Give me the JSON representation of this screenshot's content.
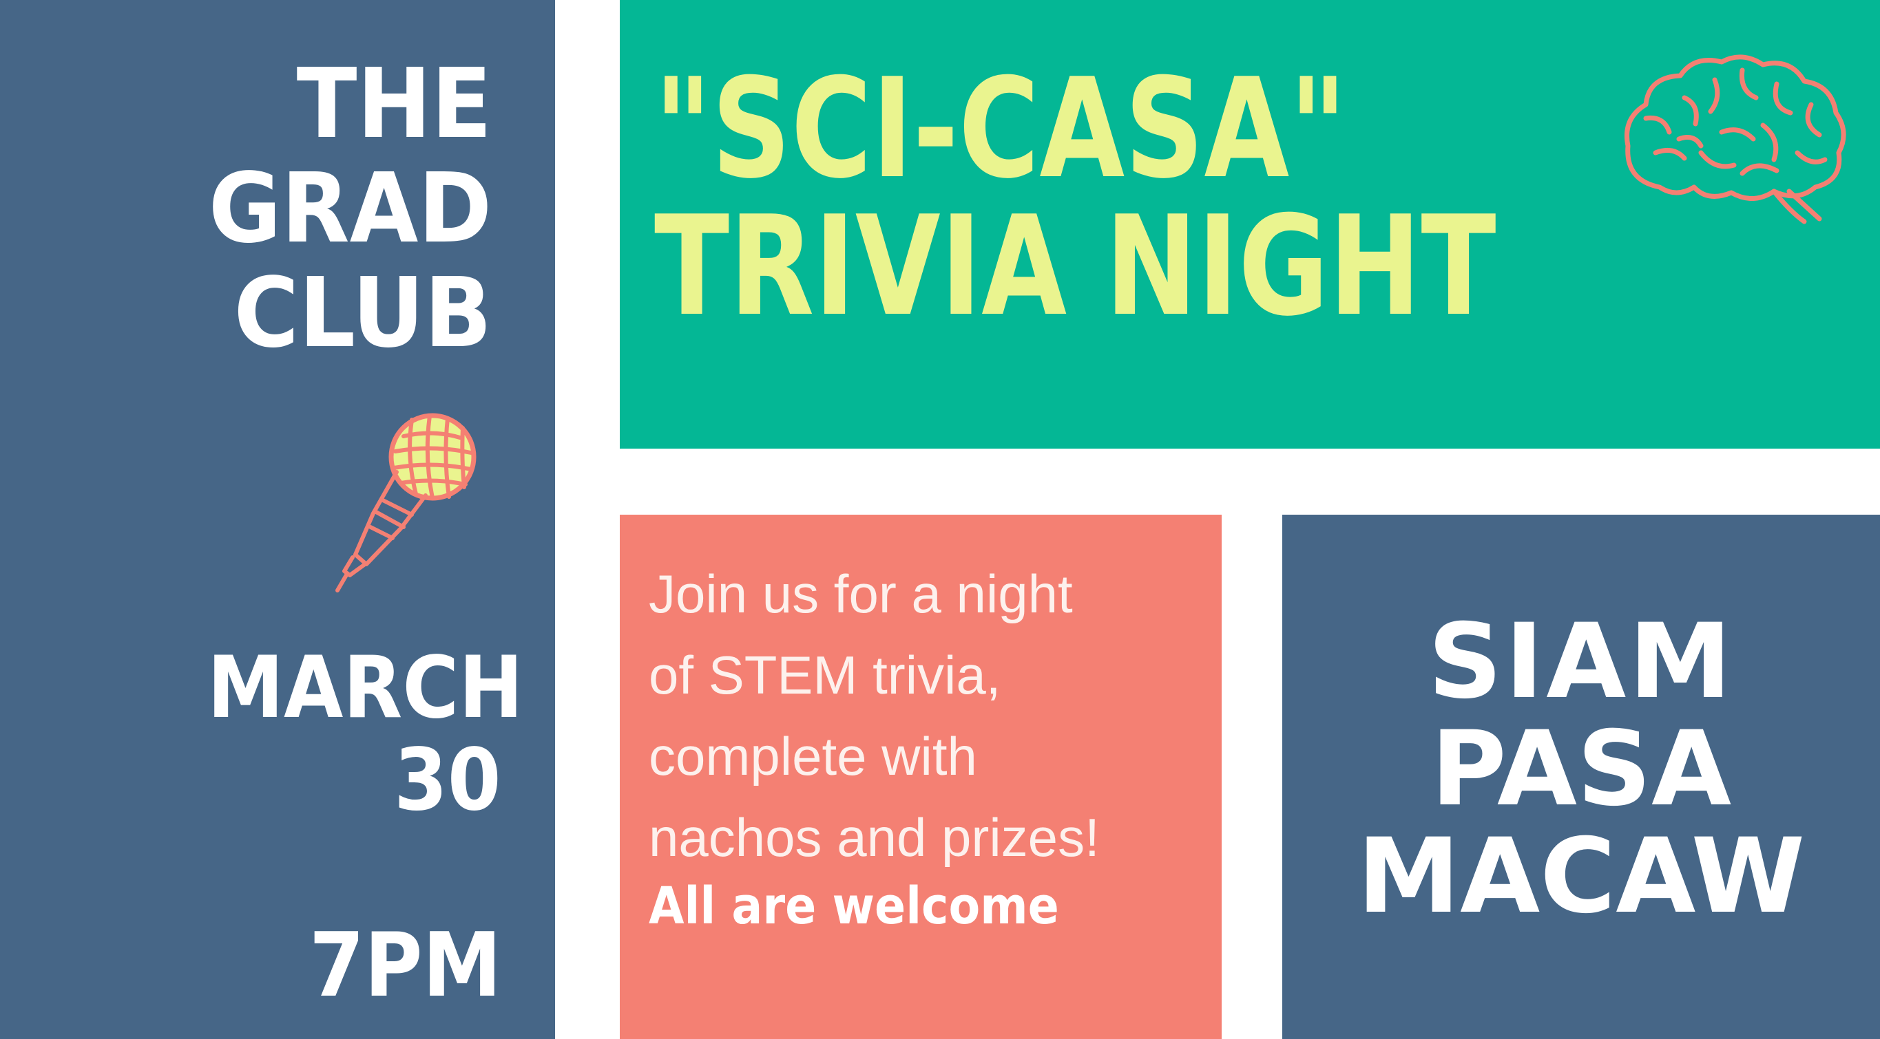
{
  "venue": {
    "lines": [
      "THE",
      "GRAD",
      "CLUB"
    ]
  },
  "date": {
    "month": "MARCH",
    "day": "30",
    "time": "7PM"
  },
  "title": {
    "line1": "\"SCI-CASA\"",
    "line2": "TRIVIA NIGHT"
  },
  "description": {
    "lines": [
      "Join us for a night",
      "of STEM trivia,",
      "complete with",
      "nachos and prizes!"
    ],
    "emphasis": "All are welcome"
  },
  "hosts": {
    "lines": [
      "SIAM",
      "PASA",
      "MACAW"
    ]
  },
  "icons": {
    "microphone": "microphone-icon",
    "brain": "brain-icon"
  },
  "colors": {
    "navy": "#466687",
    "teal": "#04b795",
    "coral": "#f48073",
    "yellow": "#eaf48f",
    "white": "#ffffff"
  }
}
